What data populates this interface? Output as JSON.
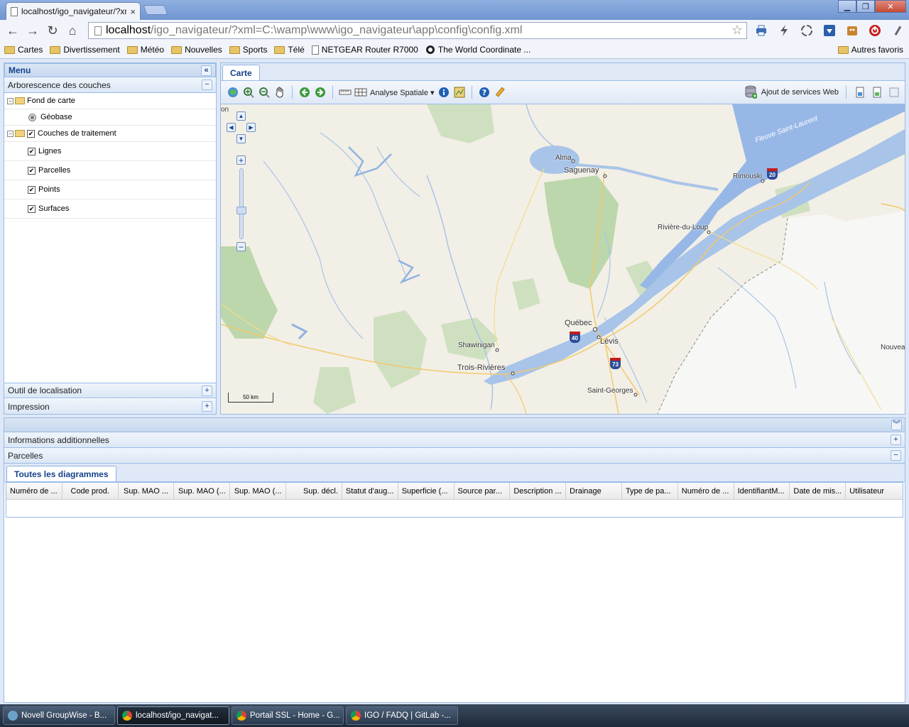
{
  "browser": {
    "tab_title": "localhost/igo_navigateur/?xn",
    "tab_close": "×",
    "url_host": "localhost",
    "url_path": "/igo_navigateur/?xml=C:\\wamp\\www\\igo_navigateur\\app\\config\\config.xml",
    "window_minimize": "▁",
    "window_restore": "❐",
    "window_close": "✕",
    "nav_icons": {
      "back": "←",
      "forward": "→",
      "reload": "↻",
      "home": "⌂",
      "star": "☆"
    },
    "extension_icons": [
      "printer-icon",
      "lightning-icon",
      "recycle-icon",
      "download-icon",
      "extension-icon",
      "power-icon",
      "wrench-icon"
    ],
    "bookmarks": [
      {
        "label": "Cartes",
        "icon": "folder"
      },
      {
        "label": "Divertissement",
        "icon": "folder"
      },
      {
        "label": "Météo",
        "icon": "folder"
      },
      {
        "label": "Nouvelles",
        "icon": "folder"
      },
      {
        "label": "Sports",
        "icon": "folder"
      },
      {
        "label": "Télé",
        "icon": "folder"
      },
      {
        "label": "NETGEAR Router R7000",
        "icon": "page"
      },
      {
        "label": "The World Coordinate ...",
        "icon": "globe"
      }
    ],
    "other_bookmarks": "Autres favoris"
  },
  "menu": {
    "title": "Menu",
    "collapse_icon": "«",
    "layer_tree_title": "Arborescence des couches",
    "layer_tree_toggle": "−",
    "groups": [
      {
        "label": "Fond de carte",
        "expand": "−",
        "children": [
          {
            "label": "Géobase",
            "type": "radio",
            "checked": true
          }
        ]
      },
      {
        "label": "Couches de traitement",
        "expand": "−",
        "checked": true,
        "children": [
          {
            "label": "Lignes",
            "type": "checkbox",
            "checked": true
          },
          {
            "label": "Parcelles",
            "type": "checkbox",
            "checked": true
          },
          {
            "label": "Points",
            "type": "checkbox",
            "checked": true
          },
          {
            "label": "Surfaces",
            "type": "checkbox",
            "checked": true
          }
        ]
      }
    ],
    "check_mark": "✔",
    "localisation_title": "Outil de localisation",
    "impression_title": "Impression",
    "expand_icon": "+"
  },
  "map": {
    "tab_label": "Carte",
    "toolbar": {
      "analyse_label": "Analyse Spatiale",
      "analyse_arrow": "▾",
      "web_services_label": "Ajout de services Web"
    },
    "controls": {
      "pan_up": "▲",
      "pan_left": "◀",
      "pan_right": "▶",
      "pan_down": "▼",
      "zoom_in": "+",
      "zoom_out": "−"
    },
    "scale_label": "50 km",
    "labels": {
      "alma": "Alma",
      "saguenay": "Saguenay",
      "rimouski": "Rimouski",
      "riviere_du_loup": "Rivière-du-Loup",
      "quebec": "Québec",
      "levis": "Lévis",
      "shawinigan": "Shawinigan",
      "trois_rivieres": "Trois-Rivières",
      "saint_georges": "Saint-Georges",
      "nouvea": "Nouvea",
      "on": "on",
      "fleuve": "Fleuve Saint-Laurent"
    },
    "highways": {
      "a20": "20",
      "a40": "40",
      "a73": "73"
    }
  },
  "bottom": {
    "collapse_icon": "︾",
    "info_title": "Informations additionnelles",
    "info_toggle": "+",
    "parcelles_title": "Parcelles",
    "parcelles_toggle": "−",
    "diagram_tab": "Toutes les diagrammes",
    "columns": [
      "Numéro de ...",
      "Code prod.",
      "Sup. MAO ...",
      "Sup. MAO (...",
      "Sup. MAO (...",
      "Sup. décl.",
      "Statut d'aug...",
      "Superficie (...",
      "Source par...",
      "Description ...",
      "Drainage",
      "Type de pa...",
      "Numéro de ...",
      "IdentifiantM...",
      "Date de mis...",
      "Utilisateur"
    ]
  },
  "taskbar": [
    {
      "label": "Novell GroupWise - B...",
      "color": "#6aa2c9"
    },
    {
      "label": "localhost/igo_navigat...",
      "color": "#e7b53b",
      "active": true
    },
    {
      "label": "Portail SSL - Home - G...",
      "color": "#e7b53b"
    },
    {
      "label": "IGO / FADQ | GitLab -...",
      "color": "#e7b53b"
    }
  ]
}
